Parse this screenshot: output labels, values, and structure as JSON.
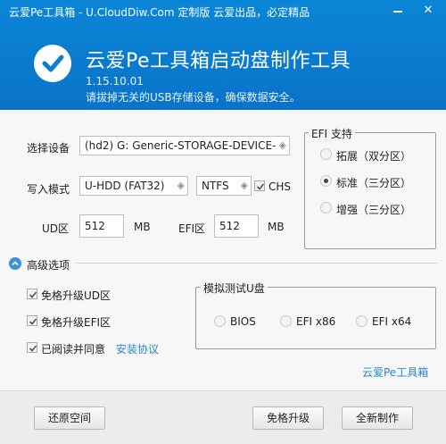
{
  "window": {
    "title": "云爱Pe工具箱 - U.CloudDiw.Com 定制版   云爱出品，必定精品",
    "minimize_glyph": "—",
    "close_glyph": "✕"
  },
  "header": {
    "app_title": "云爱Pe工具箱启动盘制作工具",
    "version": "1.15.10.01",
    "tip": "请拔掉无关的USB存储设备，确保数据安全。",
    "logo_icon": "checkmark-icon"
  },
  "device": {
    "label": "选择设备",
    "value": "(hd2) G:  Generic-STORAGE-DEVICE-"
  },
  "write_mode": {
    "label": "写入模式",
    "mode_value": "U-HDD (FAT32)",
    "fs_value": "NTFS",
    "chs_label": "CHS",
    "chs_checked": true
  },
  "partitions": {
    "ud_label": "UD区",
    "ud_value": "512",
    "ud_unit": "MB",
    "efi_label": "EFI区",
    "efi_value": "512",
    "efi_unit": "MB"
  },
  "efi_support": {
    "title": "EFI 支持",
    "options": [
      {
        "label": "拓展（双分区）",
        "selected": false
      },
      {
        "label": "标准（三分区）",
        "selected": true
      },
      {
        "label": "增强（三分区）",
        "selected": false
      }
    ]
  },
  "advanced": {
    "label": "高级选项",
    "skip_ud_upgrade": "免格升级UD区",
    "skip_efi_upgrade": "免格升级EFI区",
    "agree_label": "已阅读并同意",
    "agreement_link": "安装协议"
  },
  "simulate": {
    "title": "模拟测试U盘",
    "options": [
      "BIOS",
      "EFI x86",
      "EFI x64"
    ]
  },
  "brand_link": "云爱Pe工具箱",
  "buttons": {
    "restore": "还原空间",
    "upgrade": "免格升级",
    "create": "全新制作"
  },
  "colors": {
    "header_blue": "#0a7dd0",
    "link_blue": "#2a86d4"
  }
}
